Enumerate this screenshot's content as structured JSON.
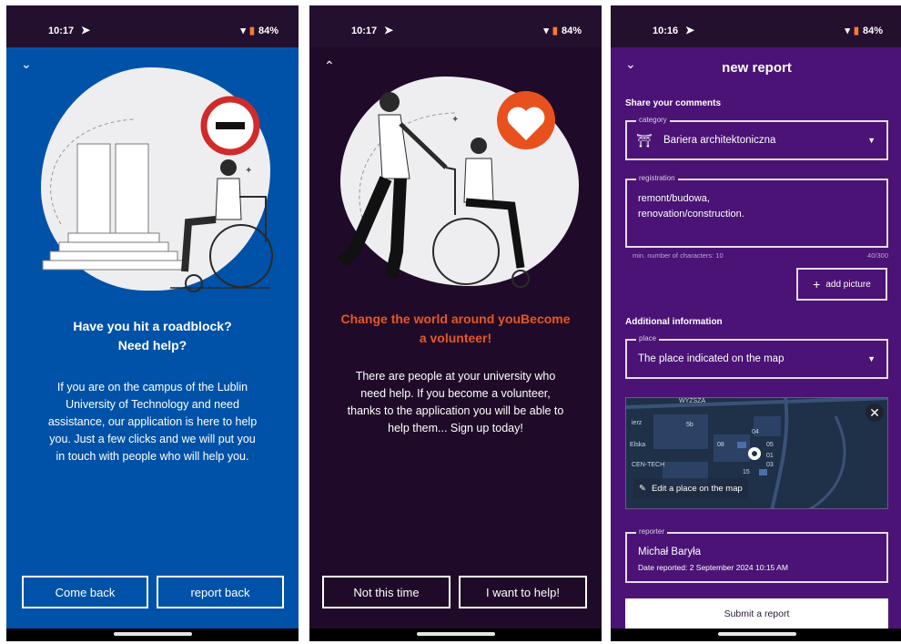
{
  "screens": [
    {
      "status": {
        "time": "10:17",
        "battery": "84%"
      },
      "title_line1": "Have you hit a roadblock?",
      "title_line2": "Need help?",
      "body_lines": [
        "If you are on the campus of the Lublin",
        "University of Technology and need",
        "assistance, our application is here to help",
        "you. Just a few clicks and we will put you",
        "in touch with people who will help you."
      ],
      "buttons": [
        "Come back",
        "report back"
      ]
    },
    {
      "status": {
        "time": "10:17",
        "battery": "84%"
      },
      "title_line1": "Change the world around youBecome",
      "title_line2": "a volunteer!",
      "body_lines": [
        "There are people at your university who",
        "need help. If you become a volunteer,",
        "thanks to the application you will be able to",
        "help them... Sign up today!"
      ],
      "buttons": [
        "Not this time",
        "I want to help!"
      ]
    },
    {
      "status": {
        "time": "10:16",
        "battery": "84%"
      },
      "header": "new report",
      "share_heading": "Share your comments",
      "category": {
        "label": "category",
        "value": "Bariera architektoniczna"
      },
      "registration": {
        "label": "registration",
        "line1": "remont/budowa,",
        "line2": "renovation/construction.",
        "helper": "min. number of characters: 10",
        "counter": "40/300"
      },
      "add_picture": "add picture",
      "additional_heading": "Additional information",
      "place": {
        "label": "place",
        "value": "The place indicated on the map"
      },
      "map": {
        "edit_label": "Edit a place on the map",
        "labels": [
          "WYZSZA",
          "ierz",
          "Elska",
          "CEN-TECH",
          "5b",
          "08",
          "04",
          "05",
          "01",
          "03",
          "15"
        ]
      },
      "reporter": {
        "label": "reporter",
        "name": "Michał Baryła",
        "date": "Date reported: 2 September 2024 10:15 AM"
      },
      "submit": "Submit a report"
    }
  ]
}
